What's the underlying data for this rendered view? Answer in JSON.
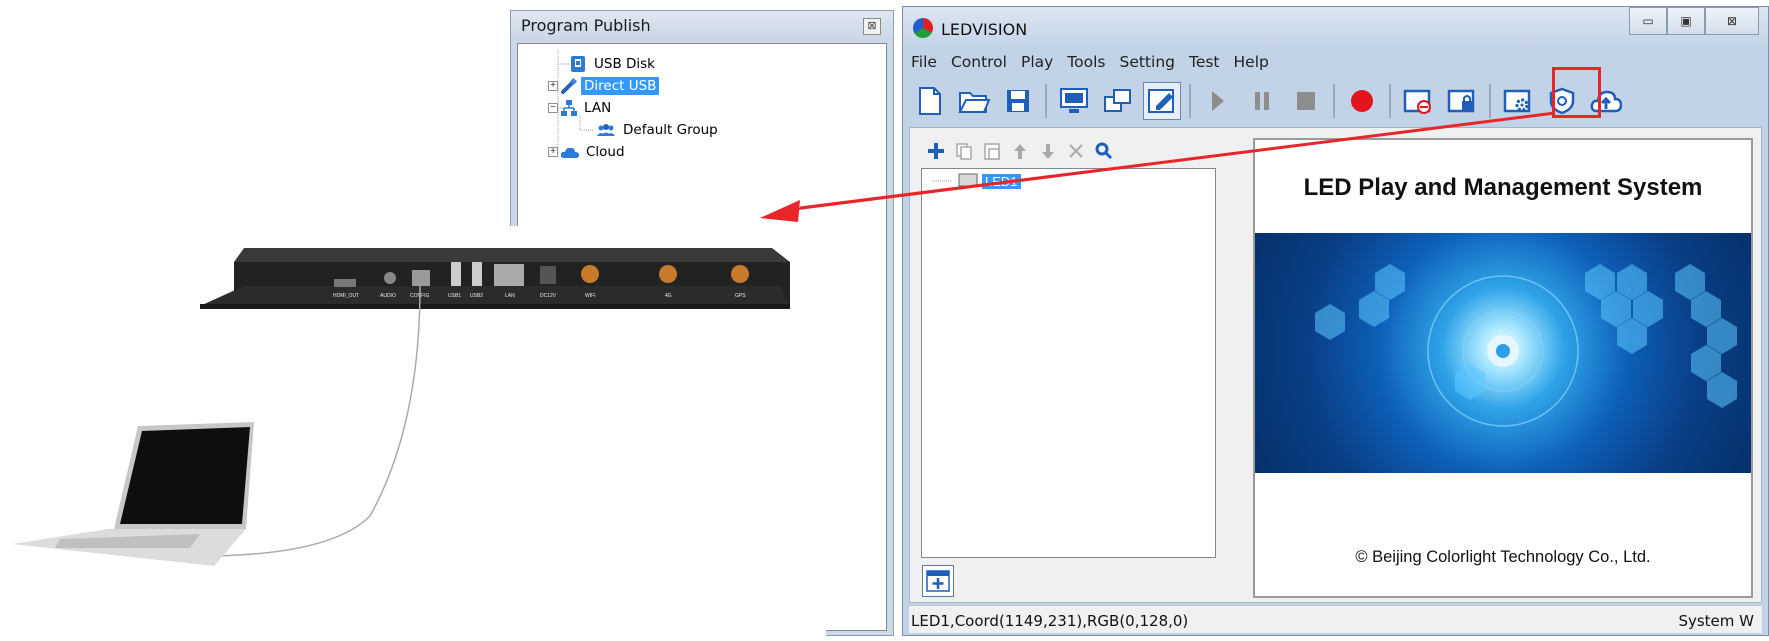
{
  "program_publish": {
    "title": "Program Publish",
    "close_glyph": "⊠",
    "tree": [
      {
        "label": "USB Disk",
        "icon": "usb-disk-icon",
        "selected": false
      },
      {
        "label": "Direct USB",
        "icon": "usb-plug-icon",
        "selected": true
      },
      {
        "label": "LAN",
        "icon": "network-icon",
        "selected": false
      },
      {
        "label": "Default Group",
        "icon": "group-icon",
        "selected": false
      },
      {
        "label": "Cloud",
        "icon": "cloud-icon",
        "selected": false
      }
    ]
  },
  "ledvision": {
    "title": "LEDVISION",
    "window_buttons": {
      "minimize": "▭",
      "maximize": "▣",
      "close": "⊠"
    },
    "menu": [
      "File",
      "Control",
      "Play",
      "Tools",
      "Setting",
      "Test",
      "Help"
    ],
    "toolbar_icons": [
      "new-file-icon",
      "open-folder-icon",
      "save-icon",
      "display-icon",
      "windows-icon",
      "edit-icon",
      "play-icon",
      "pause-icon",
      "stop-icon",
      "record-icon",
      "screen-off-icon",
      "screen-lock-icon",
      "screen-settings-icon",
      "shield-icon",
      "cloud-upload-icon"
    ],
    "led_toolbar_icons": [
      "add-icon",
      "copy-icon",
      "paste-icon",
      "up-arrow-icon",
      "down-arrow-icon",
      "delete-icon",
      "search-icon"
    ],
    "led_tree_item": "LED1",
    "splash": {
      "title": "LED Play and Management System",
      "copyright": "© Beijing Colorlight Technology Co., Ltd."
    },
    "status": {
      "left": "LED1,Coord(1149,231),RGB(0,128,0)",
      "right": "System W"
    }
  },
  "hardware": {
    "ports": [
      "HDMI_OUT",
      "AUDIO",
      "CONFIG",
      "USB1",
      "USB2",
      "LAN",
      "DC12V",
      "WIFI",
      "4G",
      "GPS"
    ]
  },
  "colors": {
    "highlight": "#e8262a",
    "selection": "#3399ff"
  }
}
